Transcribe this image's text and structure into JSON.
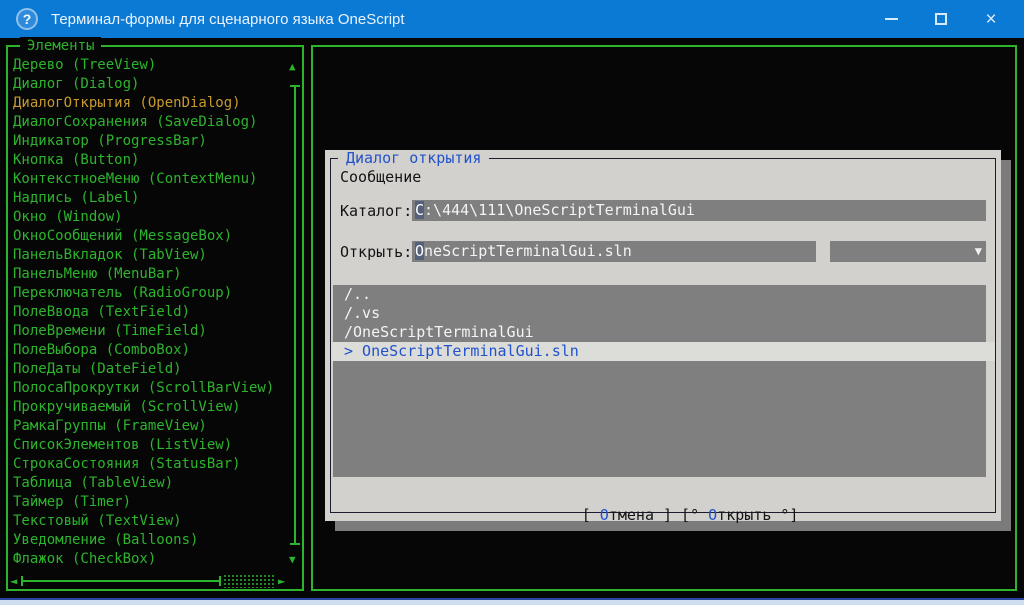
{
  "window": {
    "title": "Терминал-формы для сценарного языка OneScript",
    "help_icon": "?",
    "close_glyph": "×"
  },
  "colors": {
    "titlebar_blue": "#0b7ad5",
    "terminal_green": "#2db42d",
    "selected_orange": "#c8992c",
    "dialog_bg": "#d3d1cd",
    "field_gray": "#7f7f7f",
    "link_blue": "#2152cc"
  },
  "sidebar": {
    "title": "Элементы",
    "scroll": {
      "up": "▲",
      "down": "▼",
      "left": "◄",
      "right": "►"
    },
    "items": [
      {
        "label": "Дерево (TreeView)"
      },
      {
        "label": "Диалог (Dialog)"
      },
      {
        "label": "ДиалогОткрытия (OpenDialog)",
        "selected": true
      },
      {
        "label": "ДиалогСохранения (SaveDialog)"
      },
      {
        "label": "Индикатор (ProgressBar)"
      },
      {
        "label": "Кнопка (Button)"
      },
      {
        "label": "КонтекстноеМеню (ContextMenu)"
      },
      {
        "label": "Надпись (Label)"
      },
      {
        "label": "Окно (Window)"
      },
      {
        "label": "ОкноСообщений (MessageBox)"
      },
      {
        "label": "ПанельВкладок (TabView)"
      },
      {
        "label": "ПанельМеню (MenuBar)"
      },
      {
        "label": "Переключатель (RadioGroup)"
      },
      {
        "label": "ПолеВвода (TextField)"
      },
      {
        "label": "ПолеВремени (TimeField)"
      },
      {
        "label": "ПолеВыбора (ComboBox)"
      },
      {
        "label": "ПолеДаты (DateField)"
      },
      {
        "label": "ПолосаПрокрутки (ScrollBarView)"
      },
      {
        "label": "Прокручиваемый (ScrollView)"
      },
      {
        "label": "РамкаГруппы (FrameView)"
      },
      {
        "label": "СписокЭлементов (ListView)"
      },
      {
        "label": "СтрокаСостояния (StatusBar)"
      },
      {
        "label": "Таблица (TableView)"
      },
      {
        "label": "Таймер (Timer)"
      },
      {
        "label": "Текстовый (TextView)"
      },
      {
        "label": "Уведомление (Balloons)"
      },
      {
        "label": "Флажок (CheckBox)"
      }
    ]
  },
  "dialog": {
    "title": "Диалог открытия",
    "message_label": "Сообщение",
    "catalog_label": "Каталог:",
    "catalog_value": "C:\\444\\111\\OneScriptTerminalGui",
    "open_label": "Открыть:",
    "open_value": "OneScriptTerminalGui.sln",
    "filter_value": "",
    "combo_arrow": "▼",
    "dirs": [
      "/..",
      "/.vs",
      "/OneScriptTerminalGui"
    ],
    "selected_file": "> OneScriptTerminalGui.sln",
    "cancel_button": {
      "pre": "[ ",
      "hotkey": "О",
      "post": "тмена ]"
    },
    "open_button": {
      "pre": "[° ",
      "hotkey": "О",
      "post": "ткрыть °]"
    }
  }
}
